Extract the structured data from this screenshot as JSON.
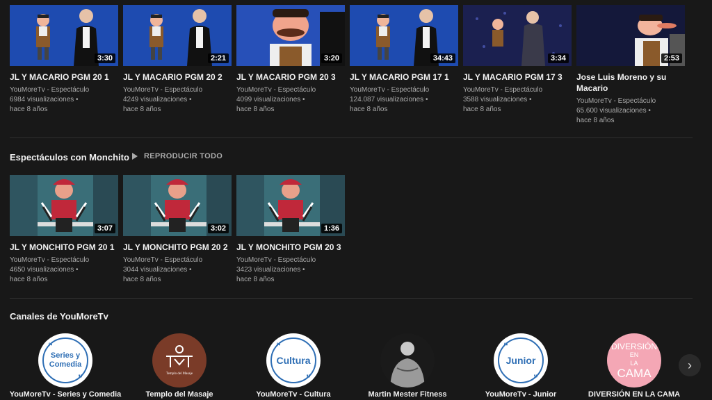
{
  "macario_videos": [
    {
      "title": "JL Y MACARIO PGM 20 1",
      "channel": "YouMoreTv - Espectáculo",
      "views": "6984 visualizaciones •",
      "age": "hace 8 años",
      "duration": "3:30",
      "scene": "duo"
    },
    {
      "title": "JL Y MACARIO PGM 20 2",
      "channel": "YouMoreTv - Espectáculo",
      "views": "4249 visualizaciones •",
      "age": "hace 8 años",
      "duration": "2:21",
      "scene": "duo"
    },
    {
      "title": "JL Y MACARIO PGM 20 3",
      "channel": "YouMoreTv - Espectáculo",
      "views": "4099 visualizaciones •",
      "age": "hace 8 años",
      "duration": "3:20",
      "scene": "closeup"
    },
    {
      "title": "JL Y MACARIO PGM 17 1",
      "channel": "YouMoreTv - Espectáculo",
      "views": "124.087 visualizaciones •",
      "age": "hace 8 años",
      "duration": "34:43",
      "scene": "duo"
    },
    {
      "title": "JL Y MACARIO PGM 17 3",
      "channel": "YouMoreTv - Espectáculo",
      "views": "3588 visualizaciones •",
      "age": "hace 8 años",
      "duration": "3:34",
      "scene": "stage"
    },
    {
      "title": "Jose Luis Moreno y su Macario",
      "channel": "YouMoreTv - Espectáculo",
      "views": "65.600 visualizaciones •",
      "age": "hace 8 años",
      "duration": "2:53",
      "scene": "closeup2"
    }
  ],
  "monchito_section": {
    "title": "Espectáculos con Monchito",
    "play_all": "REPRODUCIR TODO"
  },
  "monchito_videos": [
    {
      "title": "JL Y MONCHITO PGM 20 1",
      "channel": "YouMoreTv - Espectáculo",
      "views": "4650 visualizaciones •",
      "age": "hace 8 años",
      "duration": "3:07"
    },
    {
      "title": "JL Y MONCHITO PGM 20 2",
      "channel": "YouMoreTv - Espectáculo",
      "views": "3044 visualizaciones •",
      "age": "hace 8 años",
      "duration": "3:02"
    },
    {
      "title": "JL Y MONCHITO PGM 20 3",
      "channel": "YouMoreTv - Espectáculo",
      "views": "3423 visualizaciones •",
      "age": "hace 8 años",
      "duration": "1:36"
    }
  ],
  "channels_section": {
    "title": "Canales de YouMoreTv",
    "next_icon": "chevron-right-icon",
    "items": [
      {
        "name": "YouMoreTv - Series y Comedia",
        "logo_text": [
          "Series y",
          "Comedia"
        ],
        "style": "quote"
      },
      {
        "name": "Templo del Masaje",
        "logo_text": [
          "Templo del Masaje"
        ],
        "style": "temple"
      },
      {
        "name": "YouMoreTv - Cultura",
        "logo_text": [
          "Cultura"
        ],
        "style": "quote"
      },
      {
        "name": "Martin Mester Fitness",
        "logo_text": [],
        "style": "photo"
      },
      {
        "name": "YouMoreTv - Junior",
        "logo_text": [
          "Junior"
        ],
        "style": "quote"
      },
      {
        "name": "DIVERSIÓN EN LA CAMA",
        "logo_text": [
          "DIVERSIÓN",
          "EN",
          "LA",
          "CAMA"
        ],
        "style": "pink"
      }
    ]
  },
  "colors": {
    "background": "#181818",
    "logo_blue": "#2f6fb5",
    "pink": "#f4a7b5",
    "temple": "#7a3b28"
  }
}
